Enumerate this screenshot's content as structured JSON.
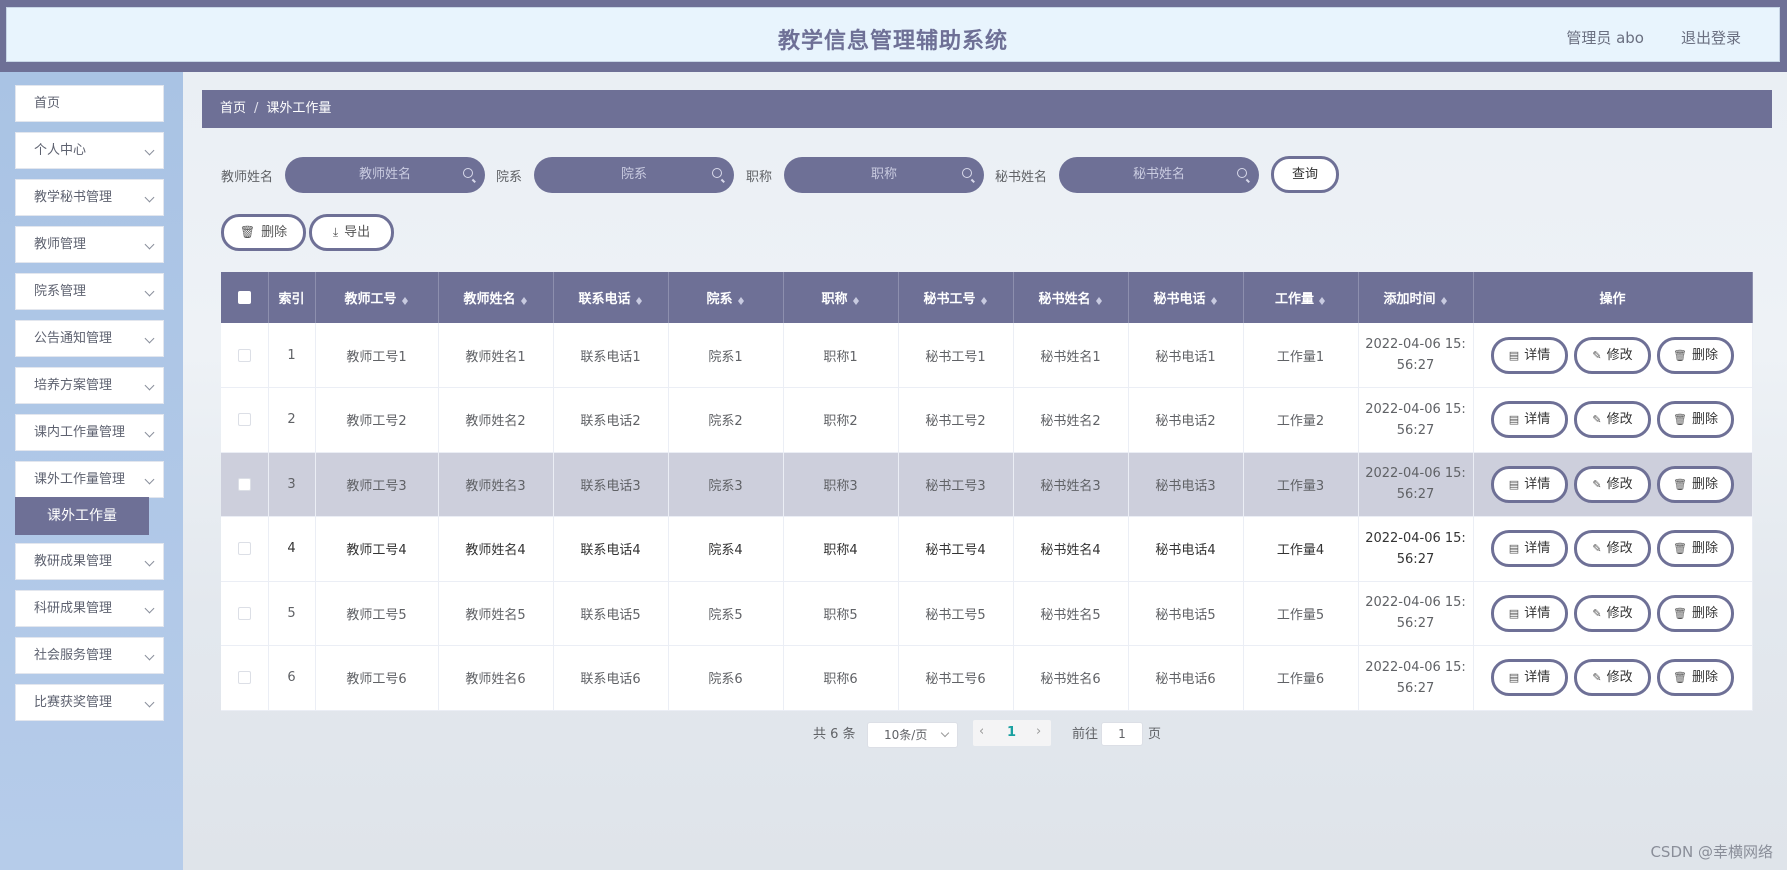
{
  "header": {
    "title": "教学信息管理辅助系统",
    "user": "管理员 abo",
    "logout": "退出登录"
  },
  "sidebar": {
    "items": [
      {
        "label": "首页",
        "has_submenu": false
      },
      {
        "label": "个人中心",
        "has_submenu": true
      },
      {
        "label": "教学秘书管理",
        "has_submenu": true
      },
      {
        "label": "教师管理",
        "has_submenu": true
      },
      {
        "label": "院系管理",
        "has_submenu": true
      },
      {
        "label": "公告通知管理",
        "has_submenu": true
      },
      {
        "label": "培养方案管理",
        "has_submenu": true
      },
      {
        "label": "课内工作量管理",
        "has_submenu": true
      },
      {
        "label": "课外工作量管理",
        "has_submenu": true
      },
      {
        "label": "教研成果管理",
        "has_submenu": true
      },
      {
        "label": "科研成果管理",
        "has_submenu": true
      },
      {
        "label": "社会服务管理",
        "has_submenu": true
      },
      {
        "label": "比赛获奖管理",
        "has_submenu": true
      }
    ],
    "active_submenu": "课外工作量"
  },
  "breadcrumb": {
    "home": "首页",
    "sep": "/",
    "current": "课外工作量"
  },
  "search": {
    "fields": [
      {
        "label": "教师姓名",
        "placeholder": "教师姓名"
      },
      {
        "label": "院系",
        "placeholder": "院系"
      },
      {
        "label": "职称",
        "placeholder": "职称"
      },
      {
        "label": "秘书姓名",
        "placeholder": "秘书姓名"
      }
    ],
    "query_button": "查询"
  },
  "actions": {
    "delete": "删除",
    "export": "导出"
  },
  "table": {
    "columns": [
      "索引",
      "教师工号",
      "教师姓名",
      "联系电话",
      "院系",
      "职称",
      "秘书工号",
      "秘书姓名",
      "秘书电话",
      "工作量",
      "添加时间",
      "操作"
    ],
    "rows": [
      [
        "1",
        "教师工号1",
        "教师姓名1",
        "联系电话1",
        "院系1",
        "职称1",
        "秘书工号1",
        "秘书姓名1",
        "秘书电话1",
        "工作量1",
        "2022-04-06 15:",
        "56:27"
      ],
      [
        "2",
        "教师工号2",
        "教师姓名2",
        "联系电话2",
        "院系2",
        "职称2",
        "秘书工号2",
        "秘书姓名2",
        "秘书电话2",
        "工作量2",
        "2022-04-06 15:",
        "56:27"
      ],
      [
        "3",
        "教师工号3",
        "教师姓名3",
        "联系电话3",
        "院系3",
        "职称3",
        "秘书工号3",
        "秘书姓名3",
        "秘书电话3",
        "工作量3",
        "2022-04-06 15:",
        "56:27"
      ],
      [
        "4",
        "教师工号4",
        "教师姓名4",
        "联系电话4",
        "院系4",
        "职称4",
        "秘书工号4",
        "秘书姓名4",
        "秘书电话4",
        "工作量4",
        "2022-04-06 15:",
        "56:27"
      ],
      [
        "5",
        "教师工号5",
        "教师姓名5",
        "联系电话5",
        "院系5",
        "职称5",
        "秘书工号5",
        "秘书姓名5",
        "秘书电话5",
        "工作量5",
        "2022-04-06 15:",
        "56:27"
      ],
      [
        "6",
        "教师工号6",
        "教师姓名6",
        "联系电话6",
        "院系6",
        "职称6",
        "秘书工号6",
        "秘书姓名6",
        "秘书电话6",
        "工作量6",
        "2022-04-06 15:",
        "56:27"
      ]
    ],
    "row_actions": {
      "detail": "详情",
      "edit": "修改",
      "delete": "删除"
    }
  },
  "pagination": {
    "total": "共 6 条",
    "page_size": "10条/页",
    "current_page": "1",
    "goto_prefix": "前往",
    "goto_value": "1",
    "goto_suffix": "页"
  },
  "watermark": "CSDN @幸横网络",
  "colors": {
    "accent": "#6e7096",
    "header_bg": "#e8f4fd",
    "sidebar_bg": "#b0c8e8",
    "highlight_row": "#cdcfdc"
  }
}
